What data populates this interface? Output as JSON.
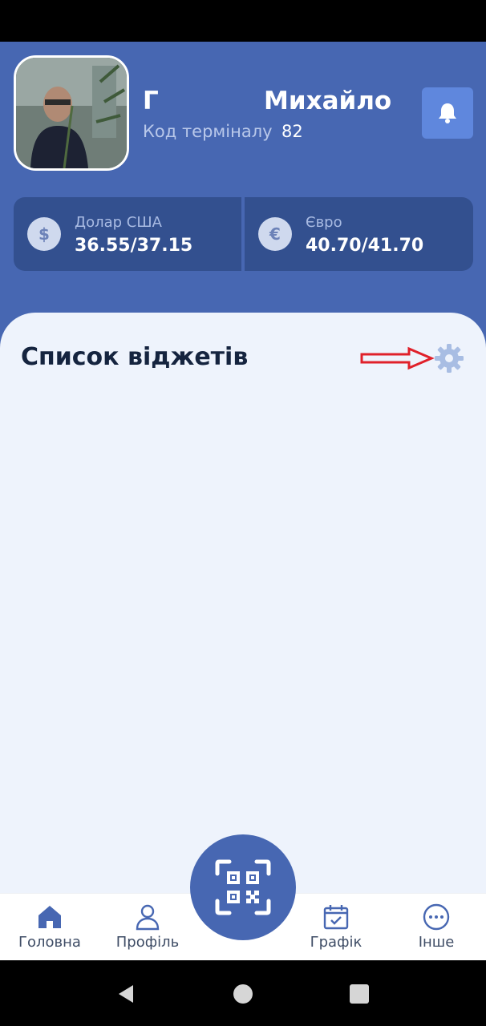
{
  "user": {
    "first_initial": "Г",
    "name": "Михайло",
    "terminal_label": "Код терміналу",
    "terminal_code": "82"
  },
  "rates": [
    {
      "currency": "Долар США",
      "symbol": "$",
      "value": "36.55/37.15"
    },
    {
      "currency": "Євро",
      "symbol": "€",
      "value": "40.70/41.70"
    }
  ],
  "widgets": {
    "title": "Список віджетів"
  },
  "bottom_nav": {
    "items": [
      {
        "label": "Головна",
        "icon": "home-icon"
      },
      {
        "label": "Профіль",
        "icon": "person-icon"
      },
      {
        "label": "Графік",
        "icon": "calendar-check-icon"
      },
      {
        "label": "Інше",
        "icon": "more-icon"
      }
    ],
    "center_icon": "qr-code-icon"
  },
  "colors": {
    "primary": "#4767b2",
    "card": "#33508f",
    "bell_button": "#5f87dd",
    "panel": "#eef3fc",
    "annotation_arrow": "#e0202a"
  }
}
